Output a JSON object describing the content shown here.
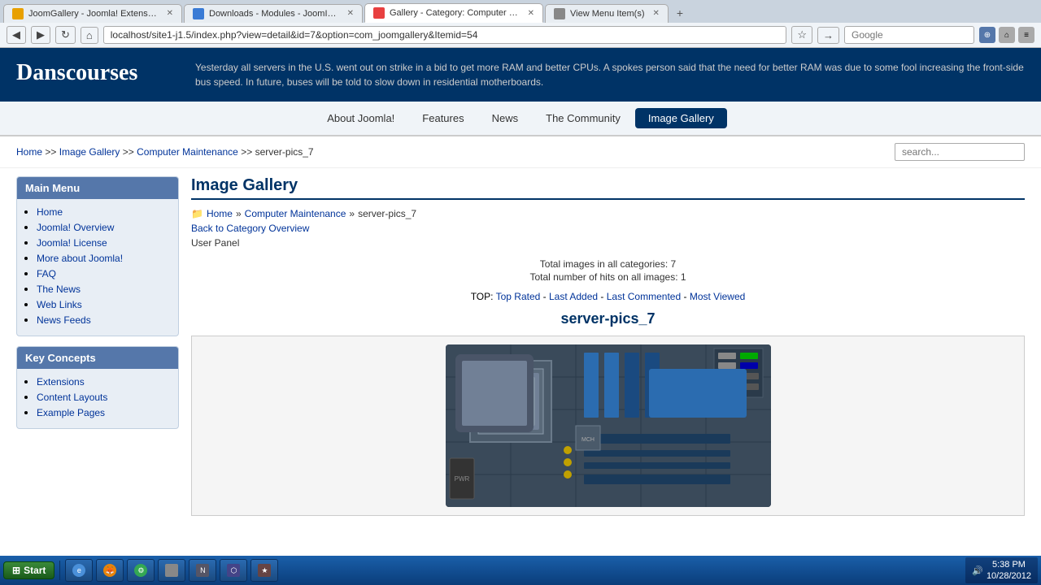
{
  "browser": {
    "tabs": [
      {
        "id": "tab1",
        "favicon_color": "#e8a000",
        "label": "JoomGallery - Joomla! Extensions Directory",
        "active": false
      },
      {
        "id": "tab2",
        "favicon_color": "#3a7bd5",
        "label": "Downloads - Modules - JoomImages",
        "active": false
      },
      {
        "id": "tab3",
        "favicon_color": "#e84040",
        "label": "Gallery - Category: Computer Maintena...",
        "active": true
      },
      {
        "id": "tab4",
        "favicon_color": "#888",
        "label": "View Menu Item(s)",
        "active": false
      }
    ],
    "url": "localhost/site1-j1.5/index.php?view=detail&id=7&option=com_joomgallery&Itemid=54",
    "search_placeholder": "Google"
  },
  "header": {
    "logo": "Danscourses",
    "news_text": "Yesterday all servers in the U.S. went out on strike in a bid to get more RAM and better CPUs. A spokes person said that the need for better RAM was due to some fool increasing the front-side bus speed. In future, buses will be told to slow down in residential motherboards."
  },
  "nav": {
    "items": [
      {
        "id": "about",
        "label": "About Joomla!",
        "active": false
      },
      {
        "id": "features",
        "label": "Features",
        "active": false
      },
      {
        "id": "news",
        "label": "News",
        "active": false
      },
      {
        "id": "community",
        "label": "The Community",
        "active": false
      },
      {
        "id": "gallery",
        "label": "Image Gallery",
        "active": true
      }
    ]
  },
  "breadcrumb": {
    "home": "Home",
    "gallery": "Image Gallery",
    "category": "Computer Maintenance",
    "current": "server-pics_7",
    "sep": ">>",
    "search_placeholder": "search..."
  },
  "sidebar": {
    "main_menu": {
      "title": "Main Menu",
      "items": [
        {
          "label": "Home",
          "href": "#"
        },
        {
          "label": "Joomla! Overview",
          "href": "#"
        },
        {
          "label": "Joomla! License",
          "href": "#"
        },
        {
          "label": "More about Joomla!",
          "href": "#"
        },
        {
          "label": "FAQ",
          "href": "#"
        },
        {
          "label": "The News",
          "href": "#"
        },
        {
          "label": "Web Links",
          "href": "#"
        },
        {
          "label": "News Feeds",
          "href": "#"
        }
      ]
    },
    "key_concepts": {
      "title": "Key Concepts",
      "items": [
        {
          "label": "Extensions",
          "href": "#"
        },
        {
          "label": "Content Layouts",
          "href": "#"
        },
        {
          "label": "Example Pages",
          "href": "#"
        }
      ]
    }
  },
  "content": {
    "page_title": "Image Gallery",
    "gallery_breadcrumb": {
      "home": "Home",
      "category": "Computer Maintenance",
      "current": "server-pics_7"
    },
    "back_link": "Back to Category Overview",
    "user_panel": "User Panel",
    "stats": {
      "total_images": "Total images in all categories: 7",
      "total_hits": "Total number of hits on all images: 1"
    },
    "top_label": "TOP:",
    "top_links": [
      {
        "label": "Top Rated",
        "href": "#"
      },
      {
        "label": "Last Added",
        "href": "#"
      },
      {
        "label": "Last Commented",
        "href": "#"
      },
      {
        "label": "Most Viewed",
        "href": "#"
      }
    ],
    "gallery_name": "server-pics_7"
  },
  "taskbar": {
    "start_label": "Start",
    "items": [
      {
        "label": "IE",
        "color": "#4a90d9"
      },
      {
        "label": "Firefox",
        "color": "#e8840a"
      },
      {
        "label": "Chrome",
        "color": "#34a853"
      },
      {
        "label": "App1",
        "color": "#888"
      },
      {
        "label": "App2",
        "color": "#555"
      },
      {
        "label": "App3",
        "color": "#777"
      },
      {
        "label": "App4",
        "color": "#444"
      }
    ],
    "clock": {
      "time": "5:38 PM",
      "date": "10/28/2012"
    }
  }
}
